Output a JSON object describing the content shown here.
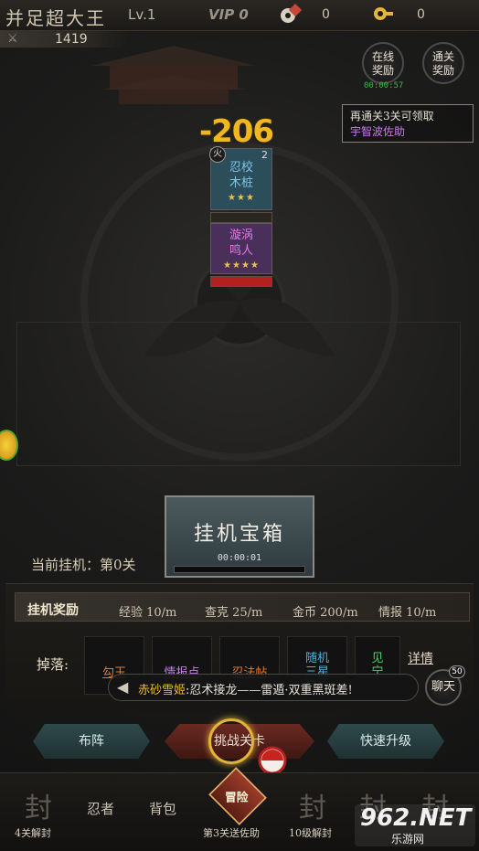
{
  "header": {
    "player_name": "并足超大王",
    "level": "Lv.1",
    "vip": "VIP 0",
    "currency1_value": "0",
    "currency2_value": "0",
    "power_value": "1419"
  },
  "side_buttons": {
    "online_reward": "在线奖励",
    "online_timer": "00:00:57",
    "clear_reward": "通关奖励"
  },
  "notice": {
    "line1": "再通关3关可领取",
    "line2": "宇智波佐助"
  },
  "battle": {
    "damage": "-206",
    "element": "火",
    "enemy_count": "2",
    "enemy_name": "忍校木桩",
    "enemy_stars": "★★★",
    "enemy_hp": 0.0,
    "ally_name": "漩涡鸣人",
    "ally_stars": "★★★★",
    "ally_hp": 1.0
  },
  "idle_chest": {
    "title": "挂机宝箱",
    "timer": "00:00:01",
    "progress": 0.0
  },
  "current_idle": "当前挂机：第0关",
  "rewards": {
    "title": "挂机奖励",
    "rates": [
      "经验 10/m",
      "查克 25/m",
      "金币 200/m",
      "情报 10/m"
    ],
    "drops_label": "掉落:",
    "drops": [
      {
        "name": "勾玉",
        "color": "#e07b2d"
      },
      {
        "name": "情报点",
        "color": "#c67be8"
      },
      {
        "name": "忍法帖",
        "color": "#e07b2d"
      },
      {
        "name": "随机三星碎片",
        "color": "#4fb1d6"
      },
      {
        "name": "见宁",
        "color": "#4fd46a"
      }
    ],
    "details_link": "详情"
  },
  "chat": {
    "sender": "赤砂雪姬",
    "message": ":忍术接龙——雷遁·双重黑斑差!",
    "button": "聊天",
    "badge": "50"
  },
  "actions": {
    "formation": "布阵",
    "challenge": "挑战关卡",
    "quick_upgrade": "快速升级"
  },
  "nav": {
    "items": [
      {
        "label": "",
        "sub": "4关解封"
      },
      {
        "label": "忍者",
        "sub": ""
      },
      {
        "label": "背包",
        "sub": ""
      },
      {
        "label": "冒险",
        "sub": "第3关送佐助"
      },
      {
        "label": "",
        "sub": "10级解封"
      },
      {
        "label": "",
        "sub": ""
      },
      {
        "label": "",
        "sub": ""
      }
    ]
  },
  "watermark": {
    "text": "962.NET",
    "sub": "乐游网"
  },
  "colors": {
    "damage": "#f0b81c",
    "enemy_card": "#2c4d5a",
    "ally_card": "#4a2f5a",
    "accent_gold": "#e3b43b",
    "online_timer": "#3fb54a"
  }
}
